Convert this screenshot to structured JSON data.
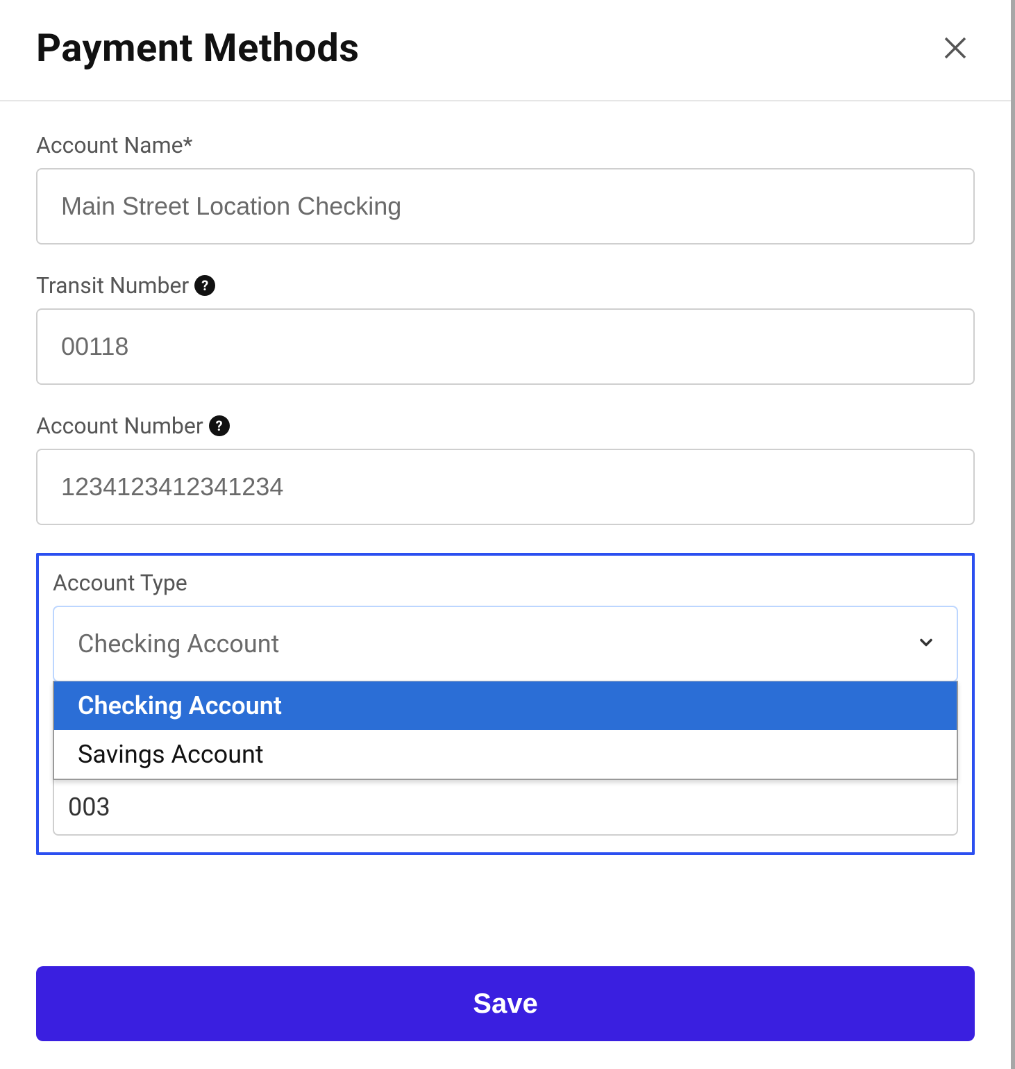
{
  "header": {
    "title": "Payment Methods"
  },
  "fields": {
    "account_name": {
      "label": "Account Name*",
      "value": "Main Street Location Checking"
    },
    "transit_number": {
      "label": "Transit Number",
      "value": "00118"
    },
    "account_number": {
      "label": "Account Number",
      "value": "1234123412341234"
    },
    "account_type": {
      "label": "Account Type",
      "selected": "Checking Account",
      "options": [
        "Checking Account",
        "Savings Account"
      ]
    },
    "visible_extra_value": "003"
  },
  "footer": {
    "save_label": "Save"
  },
  "icons": {
    "help_glyph": "?"
  }
}
